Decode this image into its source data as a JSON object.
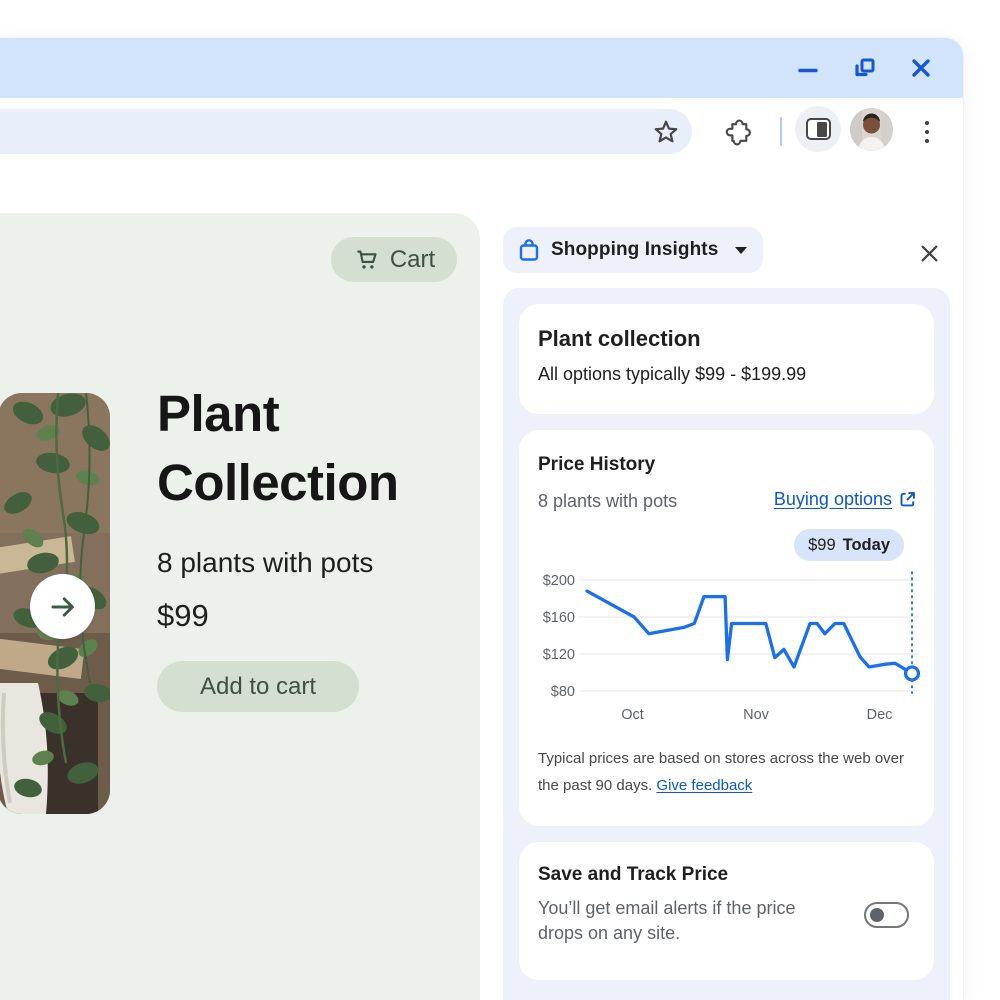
{
  "browser": {
    "window_controls": {
      "minimize": "minimize",
      "restore": "restore-window",
      "close": "close-window"
    },
    "toolbar": {
      "address_value": "",
      "icons": [
        "bookmark-star",
        "extensions-puzzle",
        "side-panel-toggle",
        "profile-avatar",
        "more-menu"
      ]
    }
  },
  "product_page": {
    "cart_button": "Cart",
    "title_line1": "Plant",
    "title_line2": "Collection",
    "subtitle": "8 plants with pots",
    "price": "$99",
    "add_to_cart": "Add to cart"
  },
  "side_panel": {
    "header": {
      "title": "Shopping Insights"
    },
    "overview_card": {
      "title": "Plant collection",
      "subtitle": "All options typically $99 - $199.99"
    },
    "price_history_card": {
      "title": "Price History",
      "subtitle": "8 plants with pots",
      "link": "Buying options",
      "badge_price": "$99",
      "badge_label": "Today",
      "disclaimer_prefix": "Typical prices are based on stores across the web over the past 90 days. ",
      "disclaimer_link": "Give feedback"
    },
    "track_card": {
      "title": "Save and Track Price",
      "body": "You’ll get email alerts if the price drops on any site.",
      "toggle_state": "off"
    }
  },
  "chart_data": {
    "type": "line",
    "title": "Price History",
    "ylabel": "",
    "xlabel": "",
    "ylim": [
      80,
      200
    ],
    "grid": true,
    "y_ticks": [
      {
        "label": "$200",
        "value": 200
      },
      {
        "label": "$160",
        "value": 160
      },
      {
        "label": "$120",
        "value": 120
      },
      {
        "label": "$80",
        "value": 80
      }
    ],
    "x_ticks": [
      {
        "label": "Oct",
        "t": 0.14
      },
      {
        "label": "Nov",
        "t": 0.52
      },
      {
        "label": "Dec",
        "t": 0.9
      }
    ],
    "series": [
      {
        "name": "Typical price",
        "points": [
          {
            "t": 0.0,
            "price": 188
          },
          {
            "t": 0.145,
            "price": 160
          },
          {
            "t": 0.19,
            "price": 142
          },
          {
            "t": 0.3,
            "price": 149
          },
          {
            "t": 0.33,
            "price": 153
          },
          {
            "t": 0.36,
            "price": 182
          },
          {
            "t": 0.425,
            "price": 182
          },
          {
            "t": 0.432,
            "price": 114
          },
          {
            "t": 0.445,
            "price": 153
          },
          {
            "t": 0.55,
            "price": 153
          },
          {
            "t": 0.578,
            "price": 116
          },
          {
            "t": 0.606,
            "price": 125
          },
          {
            "t": 0.637,
            "price": 106
          },
          {
            "t": 0.686,
            "price": 153
          },
          {
            "t": 0.708,
            "price": 153
          },
          {
            "t": 0.732,
            "price": 142
          },
          {
            "t": 0.763,
            "price": 153
          },
          {
            "t": 0.79,
            "price": 153
          },
          {
            "t": 0.84,
            "price": 117
          },
          {
            "t": 0.868,
            "price": 106
          },
          {
            "t": 0.917,
            "price": 109
          },
          {
            "t": 0.948,
            "price": 110
          },
          {
            "t": 1.0,
            "price": 99
          }
        ]
      }
    ],
    "today_marker": {
      "t": 1.0,
      "price": 99,
      "label": "$99 Today"
    }
  },
  "colors": {
    "titlebar": "#D2E3FC",
    "window_controls": "#1658D3",
    "panel_bg": "#EFF1FA",
    "card_bg": "#FFFFFF",
    "link_blue": "#0B57D0",
    "chart_line": "#1A6EF0",
    "chart_grid": "#E9EBEE",
    "badge_bg": "#D8E4FA",
    "product_bg": "#ECF1EB",
    "green_button_bg": "#D5DFD1",
    "green_button_text": "#3E5044"
  }
}
